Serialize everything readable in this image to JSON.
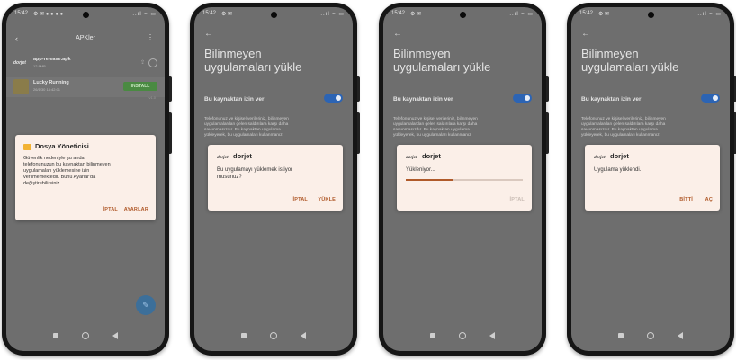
{
  "status_bar": {
    "time": "15:42",
    "icons_left_p1": "⚙ ✉ ● ● ● ●",
    "icons_left": "⚙ ✉",
    "icons_right": "..ıl ≈ ▭"
  },
  "phone1": {
    "header": {
      "back": "‹",
      "title": "APKler",
      "more": "⋮"
    },
    "file_row": {
      "logo": "dorjet",
      "name": "app-release.apk",
      "sub": "12.8MB"
    },
    "game_row": {
      "name": "Lucky Running",
      "sub": "26/1/30 14:42:01",
      "install": "INSTALL",
      "version": "v1.0"
    },
    "dialog": {
      "title": "Dosya Yöneticisi",
      "body": [
        "Güvenlik nedeniyle şu anda",
        "telefonunuzun bu kaynaktan bilinmeyen",
        "uygulamaları yüklemesine izin",
        "verilmemektedir. Bunu Ayarlar'da",
        "değiştirebilirsiniz."
      ],
      "cancel": "İPTAL",
      "settings": "AYARLAR"
    }
  },
  "settings": {
    "back": "←",
    "title_line1": "Bilinmeyen",
    "title_line2": "uygulamaları yükle",
    "allow_label": "Bu kaynaktan izin ver",
    "warning": [
      "Telefonunuz ve kişisel verileriniz, bilinmeyen",
      "uygulamalardan gelen saldırılara karşı daha",
      "savunmasızdır. Bu kaynaktan uygulama",
      "yükleyerek, bu uygulamaları kullanmanız"
    ]
  },
  "phone2": {
    "dialog": {
      "logo": "dorjet",
      "app": "dorjet",
      "question_line1": "Bu uygulamayı yüklemek istiyor",
      "question_line2": "musunuz?",
      "cancel": "İPTAL",
      "install": "YÜKLE"
    }
  },
  "phone3": {
    "dialog": {
      "logo": "dorjet",
      "app": "dorjet",
      "status": "Yükleniyor...",
      "cancel": "İPTAL",
      "progress": 0.4
    }
  },
  "phone4": {
    "dialog": {
      "logo": "dorjet",
      "app": "dorjet",
      "message": "Uygulama yüklendi.",
      "done": "BİTTİ",
      "open": "AÇ"
    }
  },
  "colors": {
    "accent": "#b05a2a",
    "toggle": "#2c64b4",
    "dialog_bg": "#fbefe8"
  }
}
